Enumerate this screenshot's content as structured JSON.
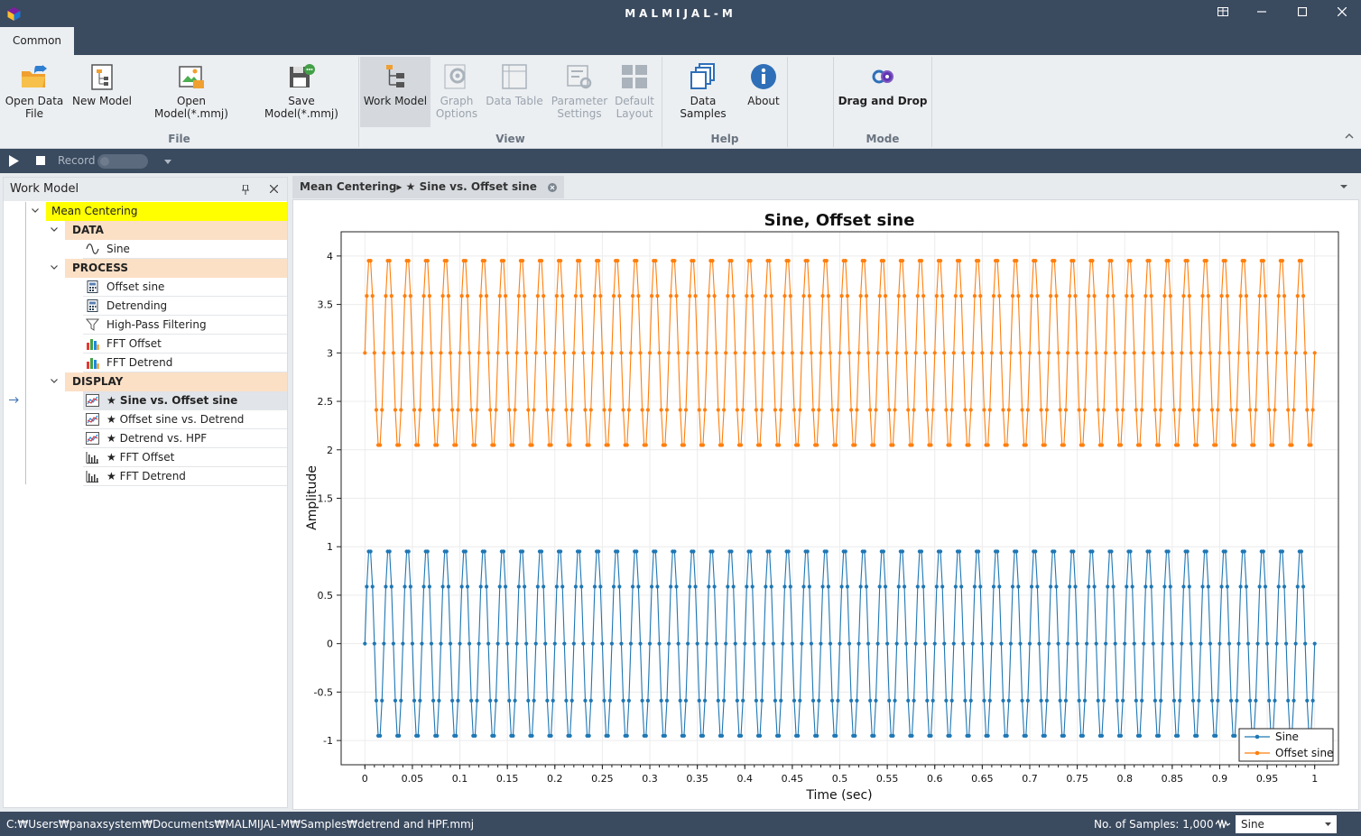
{
  "app": {
    "title": "MALMIJAL-M"
  },
  "ribbon": {
    "tab": "Common",
    "buttons": {
      "open_data_file": "Open Data\nFile",
      "new_model": "New Model",
      "open_model": "Open Model(*.mmj)",
      "save_model": "Save Model(*.mmj)",
      "work_model": "Work Model",
      "graph_options": "Graph\nOptions",
      "data_table": "Data Table",
      "parameter_settings": "Parameter\nSettings",
      "default_layout": "Default\nLayout",
      "data_samples": "Data Samples",
      "about": "About",
      "drag_and_drop": "Drag and Drop"
    },
    "groups": {
      "file": "File",
      "view": "View",
      "help": "Help",
      "mode": "Mode"
    }
  },
  "toolbar": {
    "record_label": "Record",
    "record_on": false
  },
  "work_model": {
    "title": "Work Model",
    "root": "Mean Centering",
    "sections": [
      {
        "label": "DATA",
        "items": [
          {
            "label": "Sine",
            "icon": "sine-wave-icon"
          }
        ]
      },
      {
        "label": "PROCESS",
        "items": [
          {
            "label": "Offset sine",
            "icon": "calculator-icon"
          },
          {
            "label": "Detrending",
            "icon": "calculator-icon"
          },
          {
            "label": "High-Pass Filtering",
            "icon": "filter-icon"
          },
          {
            "label": "FFT Offset",
            "icon": "bar-chart-icon"
          },
          {
            "label": "FFT Detrend",
            "icon": "bar-chart-icon"
          }
        ]
      },
      {
        "label": "DISPLAY",
        "items": [
          {
            "label": "★ Sine vs. Offset sine",
            "icon": "line-chart-icon",
            "selected": true
          },
          {
            "label": "★ Offset sine vs. Detrend",
            "icon": "line-chart-icon"
          },
          {
            "label": "★ Detrend vs. HPF",
            "icon": "line-chart-icon"
          },
          {
            "label": "★ FFT Offset",
            "icon": "spectrum-icon"
          },
          {
            "label": "★ FFT Detrend",
            "icon": "spectrum-icon"
          }
        ]
      }
    ]
  },
  "document_tab": {
    "label": "Mean Centering▸ ★ Sine vs. Offset sine"
  },
  "chart_data": {
    "type": "line",
    "title": "Sine, Offset sine",
    "xlabel": "Time (sec)",
    "ylabel": "Amplitude",
    "xlim": [
      -0.025,
      1.025
    ],
    "ylim": [
      -1.25,
      4.25
    ],
    "xticks": [
      "0",
      "0.05",
      "0.1",
      "0.15",
      "0.2",
      "0.25",
      "0.3",
      "0.35",
      "0.4",
      "0.45",
      "0.5",
      "0.55",
      "0.6",
      "0.65",
      "0.7",
      "0.75",
      "0.8",
      "0.85",
      "0.9",
      "0.95",
      "1"
    ],
    "yticks": [
      "-1",
      "-0.5",
      "0",
      "0.5",
      "1",
      "1.5",
      "2",
      "2.5",
      "3",
      "3.5",
      "4"
    ],
    "grid": true,
    "legend_position": "bottom-right",
    "samples": 1000,
    "frequency_hz": 50,
    "displayed_sample_step_sec": 0.002,
    "series": [
      {
        "name": "Sine",
        "formula": "sin(2π·50·t)",
        "offset": 0,
        "color": "#1f77b4"
      },
      {
        "name": "Offset sine",
        "formula": "3 + sin(2π·50·t)",
        "offset": 3,
        "color": "#ff7f0e"
      }
    ]
  },
  "status": {
    "path": "C:₩Users₩panaxsystem₩Documents₩MALMIJAL-M₩Samples₩detrend and HPF.mmj",
    "samples": "No. of Samples: 1,000",
    "selected_series": "Sine"
  }
}
